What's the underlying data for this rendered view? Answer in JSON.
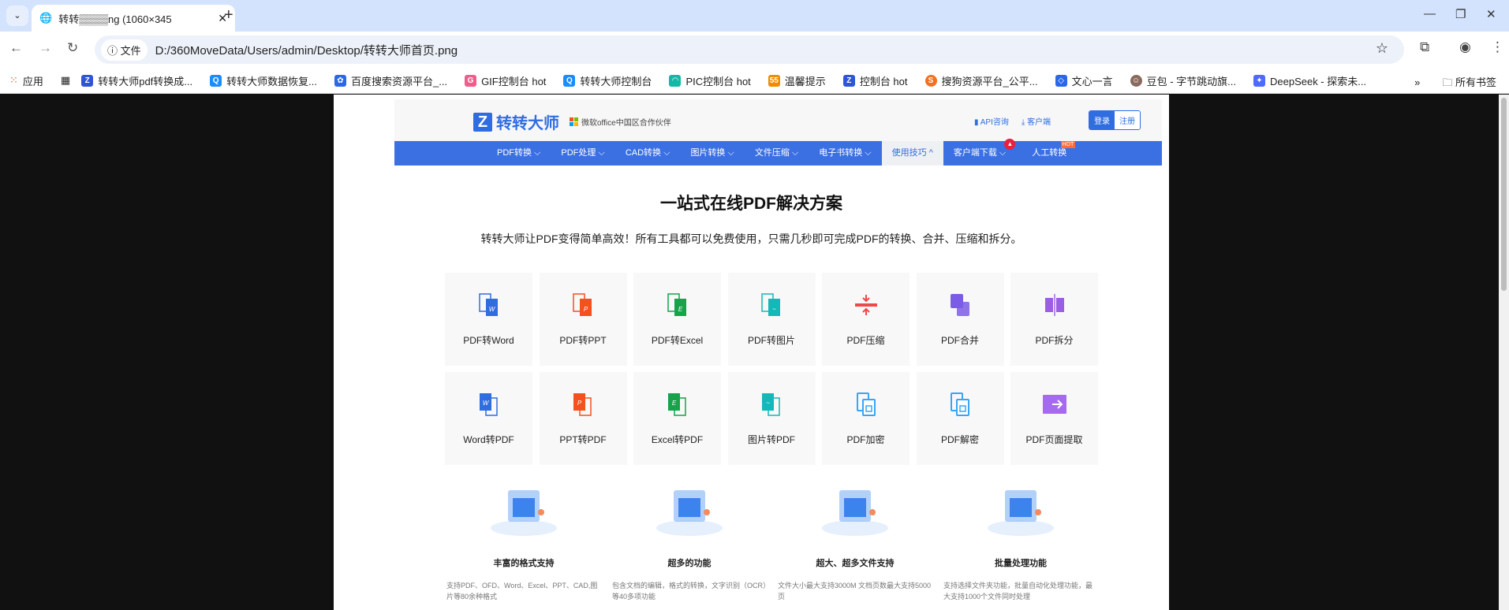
{
  "browser": {
    "tab_title": "转转▒▒▒▒ng (1060×345",
    "address_chip": "文件",
    "url": "D:/360MoveData/Users/admin/Desktop/转转大师首页.png",
    "bookmarks": [
      {
        "label": "应用",
        "color": "#ea4335"
      },
      {
        "label": "转转大师pdf转换成...",
        "color": "#2f55d4"
      },
      {
        "label": "转转大师数据恢复...",
        "color": "#1a8cff"
      },
      {
        "label": "百度搜索资源平台_...",
        "color": "#2b68e8"
      },
      {
        "label": "GIF控制台 hot",
        "color": "#f45b8c"
      },
      {
        "label": "转转大师控制台",
        "color": "#1a8cff"
      },
      {
        "label": "PIC控制台 hot",
        "color": "#14b8a6"
      },
      {
        "label": "温馨提示",
        "color": "#f28b00"
      },
      {
        "label": "控制台 hot",
        "color": "#2f55d4"
      },
      {
        "label": "搜狗资源平台_公平...",
        "color": "#f37021"
      },
      {
        "label": "文心一言",
        "color": "#2b68e8"
      },
      {
        "label": "豆包 - 字节跳动旗...",
        "color": "#8a6a5c"
      },
      {
        "label": "DeepSeek - 探索未...",
        "color": "#4d6bfe"
      }
    ],
    "all_bookmarks": "所有书签"
  },
  "site": {
    "logo": "转转大师",
    "partner": "微软office中国区合作伙伴",
    "api": "API咨询",
    "client": "客户端",
    "login": "登录",
    "register": "注册",
    "menu": [
      {
        "label": "PDF转换 ⌵"
      },
      {
        "label": "PDF处理 ⌵"
      },
      {
        "label": "CAD转换 ⌵"
      },
      {
        "label": "图片转换 ⌵"
      },
      {
        "label": "文件压缩 ⌵"
      },
      {
        "label": "电子书转换 ⌵"
      },
      {
        "label": "使用技巧 ^"
      },
      {
        "label": "客户端下载 ⌵"
      },
      {
        "label": "人工转换"
      }
    ],
    "hot_badge": "HOT",
    "title": "一站式在线PDF解决方案",
    "subtitle": "转转大师让PDF变得简单高效！所有工具都可以免费使用，只需几秒即可完成PDF的转换、合并、压缩和拆分。",
    "tools": [
      {
        "label": "PDF转Word",
        "color": "#2f6de0"
      },
      {
        "label": "PDF转PPT",
        "color": "#f4511e"
      },
      {
        "label": "PDF转Excel",
        "color": "#16a34a"
      },
      {
        "label": "PDF转图片",
        "color": "#14b8b8"
      },
      {
        "label": "PDF压缩",
        "color": "#f04848"
      },
      {
        "label": "PDF合并",
        "color": "#7b5ce6"
      },
      {
        "label": "PDF拆分",
        "color": "#9b5de5"
      },
      {
        "label": "Word转PDF",
        "color": "#2f6de0"
      },
      {
        "label": "PPT转PDF",
        "color": "#f4511e"
      },
      {
        "label": "Excel转PDF",
        "color": "#16a34a"
      },
      {
        "label": "图片转PDF",
        "color": "#14b8b8"
      },
      {
        "label": "PDF加密",
        "color": "#38a5f5"
      },
      {
        "label": "PDF解密",
        "color": "#38a5f5"
      },
      {
        "label": "PDF页面提取",
        "color": "#a66af0"
      }
    ],
    "features": [
      {
        "title": "丰富的格式支持",
        "desc": "支持PDF、OFD、Word、Excel、PPT、CAD,图片等80余种格式"
      },
      {
        "title": "超多的功能",
        "desc": "包含文档的编辑，格式的转换，文字识别（OCR）等40多项功能"
      },
      {
        "title": "超大、超多文件支持",
        "desc": "文件大小最大支持3000M 文档页数最大支持5000页"
      },
      {
        "title": "批量处理功能",
        "desc": "支持选择文件夹功能，批量自动化处理功能，最大支持1000个文件同时处理"
      }
    ]
  }
}
